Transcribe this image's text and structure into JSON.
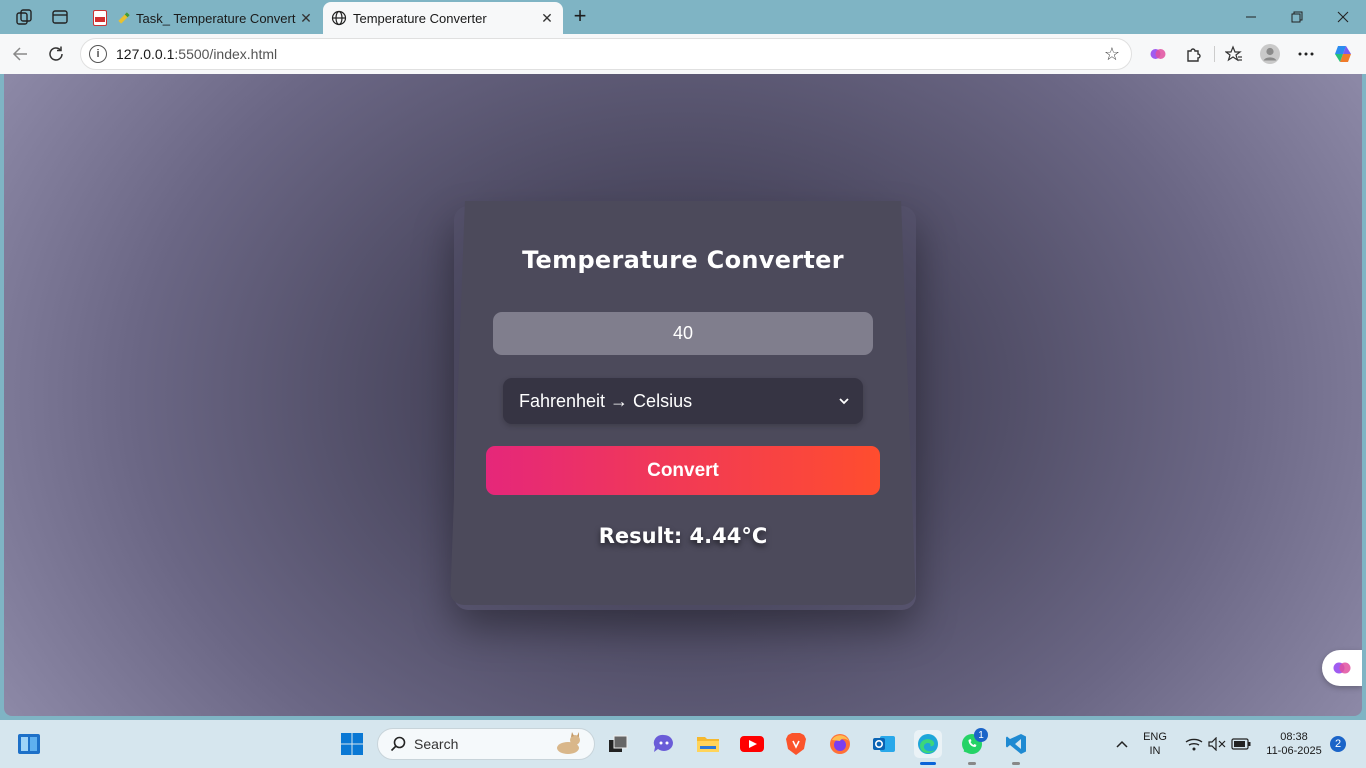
{
  "browser": {
    "tabs": [
      {
        "label": "Task_ Temperature Converter[",
        "favicon": "pdf-icon"
      },
      {
        "label": "Temperature Converter",
        "favicon": "globe-icon",
        "active": true
      }
    ],
    "url_host": "127.0.0.1",
    "url_rest": ":5500/index.html"
  },
  "app": {
    "title": "Temperature Converter",
    "input_value": "40",
    "conversion_selected": "Fahrenheit → Celsius",
    "convert_label": "Convert",
    "result": "Result: 4.44°C"
  },
  "colors": {
    "button_gradient_start": "#e5277a",
    "button_gradient_end": "#ff4d2e",
    "card_bg": "#4c4a5b",
    "page_bg": "#3a3748"
  },
  "taskbar": {
    "search_placeholder": "Search",
    "whatsapp_badge": "1",
    "lang_line1": "ENG",
    "lang_line2": "IN",
    "time": "08:38",
    "date": "11-06-2025",
    "notification_count": "2"
  }
}
